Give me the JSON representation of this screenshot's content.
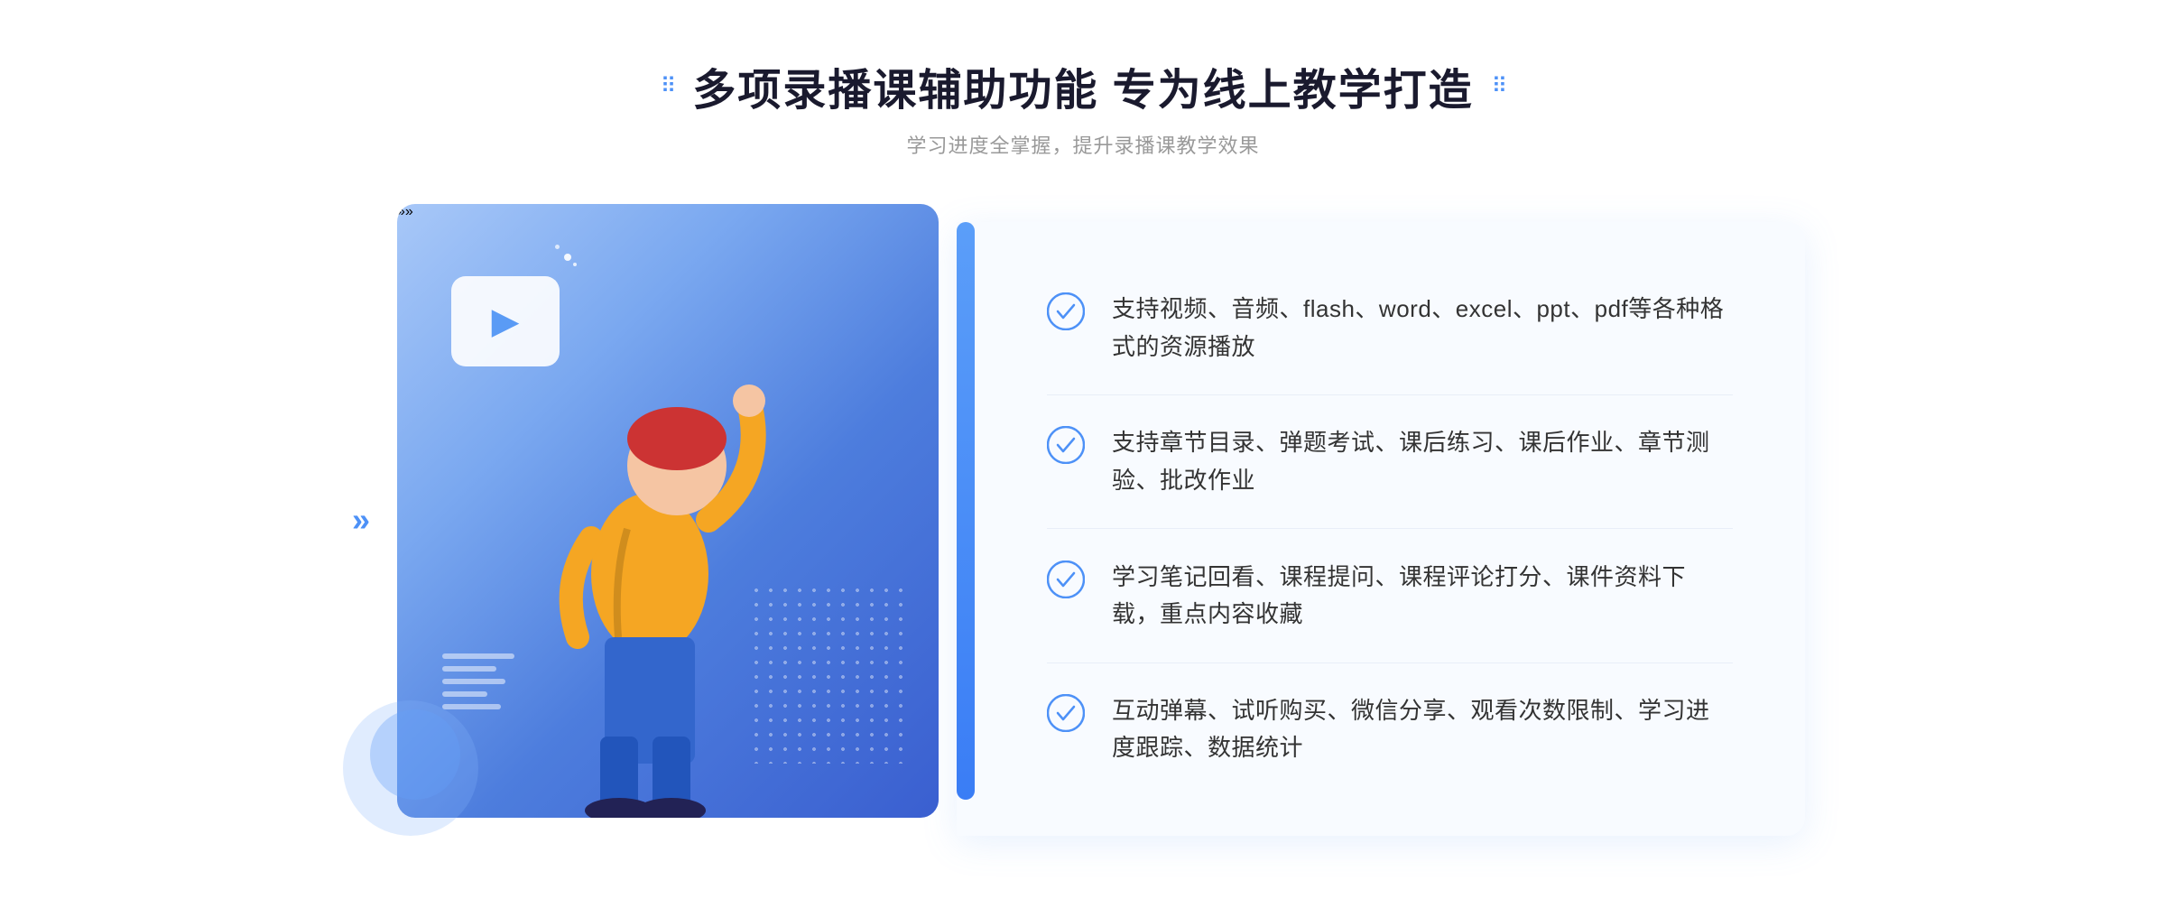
{
  "header": {
    "title": "多项录播课辅助功能 专为线上教学打造",
    "subtitle": "学习进度全掌握，提升录播课教学效果",
    "dot_icon_left": "⠿",
    "dot_icon_right": "⠿"
  },
  "features": [
    {
      "id": 1,
      "text": "支持视频、音频、flash、word、excel、ppt、pdf等各种格式的资源播放"
    },
    {
      "id": 2,
      "text": "支持章节目录、弹题考试、课后练习、课后作业、章节测验、批改作业"
    },
    {
      "id": 3,
      "text": "学习笔记回看、课程提问、课程评论打分、课件资料下载，重点内容收藏"
    },
    {
      "id": 4,
      "text": "互动弹幕、试听购买、微信分享、观看次数限制、学习进度跟踪、数据统计"
    }
  ],
  "colors": {
    "accent_blue": "#4d91f7",
    "title_dark": "#1a1a2e",
    "text_gray": "#999",
    "feature_text": "#333",
    "panel_bg": "#f8fbff",
    "divider": "#e8eef8"
  },
  "decorations": {
    "left_arrow": "»",
    "outer_dots": "⁚"
  }
}
